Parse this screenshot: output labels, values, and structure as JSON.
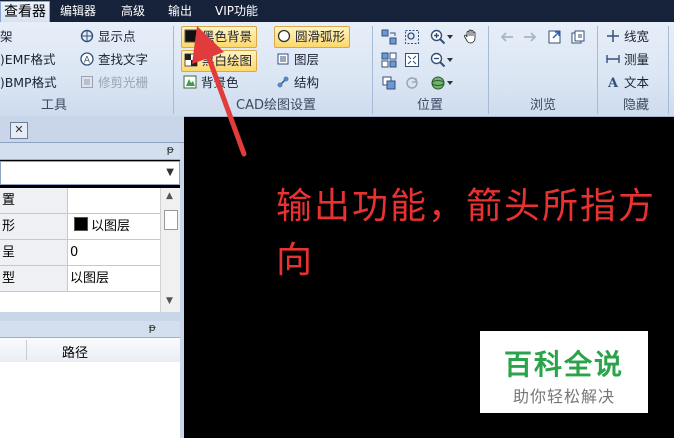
{
  "menu": {
    "tabs": [
      "查看器",
      "编辑器",
      "高级",
      "输出",
      "VIP功能"
    ],
    "active_tab": "查看器"
  },
  "ribbon": {
    "tools_group": {
      "label": "工具",
      "items": [
        "架",
        "EMF格式",
        "BMP格式"
      ],
      "items2": [
        "显示点",
        "查找文字",
        "修剪光栅"
      ]
    },
    "cad_group": {
      "label": "CAD绘图设置",
      "col1": [
        "黑色背景",
        "黑白绘图",
        "背景色"
      ],
      "col2": [
        "圆滑弧形",
        "图层",
        "结构"
      ]
    },
    "position_group": {
      "label": "位置"
    },
    "browse_group": {
      "label": "浏览"
    },
    "hide_group": {
      "label": "隐藏",
      "items": [
        "线宽",
        "测量",
        "文本"
      ]
    }
  },
  "left_panel": {
    "close_glyph": "✕",
    "pin_glyph": "ᵽ",
    "properties": [
      {
        "name": "置",
        "value": ""
      },
      {
        "name": "形",
        "value": "以图层",
        "swatch": "#000000"
      },
      {
        "name": "呈",
        "value": "0"
      },
      {
        "name": "型",
        "value": "以图层"
      }
    ],
    "path_column": "路径"
  },
  "canvas": {
    "annotation": "输出功能，箭头所指方向",
    "watermark_title": "百科全说",
    "watermark_sub": "助你轻松解决",
    "arrow_color": "#e23b3b",
    "annotation_color": "#e83232"
  }
}
